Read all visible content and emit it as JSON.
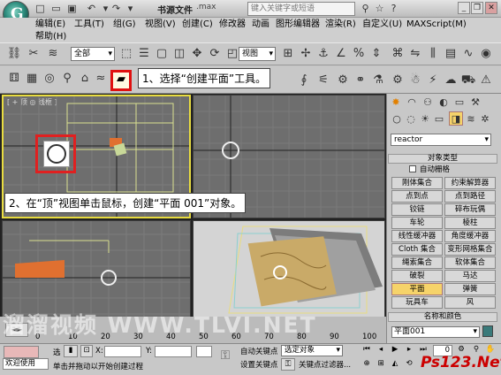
{
  "title_bar": {
    "file_name": "书源文件",
    "file_ext": ".max",
    "search_placeholder": "键入关键字或短语",
    "minimize": "_",
    "restore": "❐",
    "close": "✕"
  },
  "menu": {
    "items": [
      "编辑(E)",
      "工具(T)",
      "组(G)",
      "视图(V)",
      "创建(C)",
      "修改器",
      "动画",
      "图形编辑器",
      "渲染(R)",
      "自定义(U)",
      "MAXScript(M)",
      "帮助(H)"
    ]
  },
  "toolbar": {
    "selection_filter": "全部",
    "ref_coord": "视图"
  },
  "callouts": {
    "step1": "1、选择“创建平面”工具。",
    "step2": "2、在“顶”视图单击鼠标，创建“平面 001”对象。"
  },
  "viewports": {
    "top_label": "[ + 顶 ◎ 线框 ]"
  },
  "command_panel": {
    "category": "reactor",
    "object_type_header": "对象类型",
    "autogrid": "自动栅格",
    "buttons": [
      [
        "刚体集合",
        "约束解算器"
      ],
      [
        "点到点",
        "点到路径"
      ],
      [
        "铰链",
        "碎布玩偶"
      ],
      [
        "车轮",
        "棱柱"
      ],
      [
        "线性缓冲器",
        "角度缓冲器"
      ],
      [
        "Cloth 集合",
        "变形网格集合"
      ],
      [
        "绳索集合",
        "软体集合"
      ],
      [
        "破裂",
        "马达"
      ],
      [
        "平面",
        "弹簧"
      ],
      [
        "玩具车",
        "风"
      ]
    ],
    "active_button": "平面",
    "name_color_header": "名称和颜色",
    "object_name": "平面001",
    "name_color_hex": "#3a7a7a"
  },
  "timeline": {
    "ticks": [
      "0",
      "10",
      "20",
      "30",
      "40",
      "50",
      "60",
      "70",
      "80",
      "90",
      "100"
    ]
  },
  "status": {
    "selection_prefix": "选",
    "welcome": "欢迎使用",
    "x_label": "X:",
    "y_label": "Y:",
    "prompt": "单击并拖动以开始创建过程",
    "auto_key": "自动关键点",
    "set_key": "设置关键点",
    "selected_object": "选定对象",
    "key_filters": "关键点过滤器...",
    "frame_value": "0"
  },
  "watermarks": {
    "site_cn": "溜溜视频",
    "site_url": "WWW.TLVI.NET",
    "ps_logo": "Ps123.Net"
  }
}
